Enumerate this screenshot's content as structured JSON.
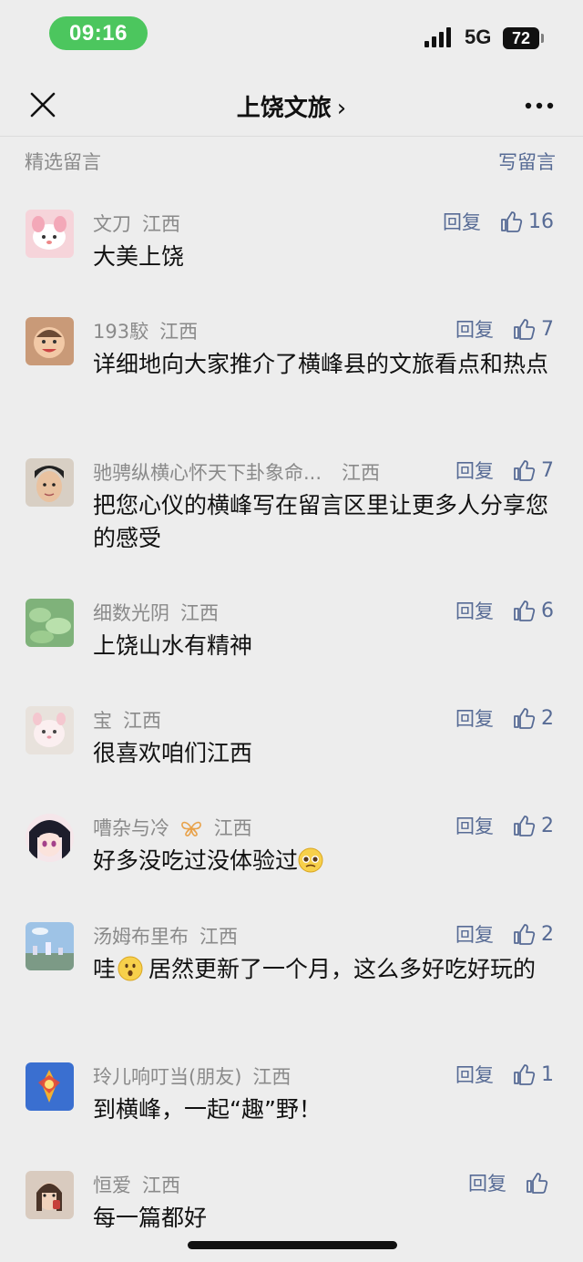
{
  "status_bar": {
    "time": "09:16",
    "network": "5G",
    "battery": "72"
  },
  "nav": {
    "title": "上饶文旅",
    "chevron": "›",
    "close_icon": "close-icon",
    "more_icon": "more-icon"
  },
  "section": {
    "title": "精选留言",
    "write_label": "写留言"
  },
  "reply_label": "回复",
  "comments": [
    {
      "name": "文刀",
      "region": "江西",
      "likes": "16",
      "text": "大美上饶"
    },
    {
      "name": "193駮",
      "region": "江西",
      "likes": "7",
      "text": "详细地向大家推介了横峰县的文旅看点和热点"
    },
    {
      "name": "驰骋纵横心怀天下卦象命...",
      "region": "江西",
      "likes": "7",
      "text": "把您心仪的横峰写在留言区里让更多人分享您的感受"
    },
    {
      "name": "细数光阴",
      "region": "江西",
      "likes": "6",
      "text": "上饶山水有精神"
    },
    {
      "name": "宝",
      "region": "江西",
      "likes": "2",
      "text": "很喜欢咱们江西"
    },
    {
      "name": "嘈杂与冷",
      "name_icon": "butterfly-icon",
      "region": "江西",
      "likes": "2",
      "text": "好多没吃过没体验过",
      "emoji": "pleading-face-emoji"
    },
    {
      "name": "汤姆布里布",
      "region": "江西",
      "likes": "2",
      "text_before": "哇",
      "emoji": "hushed-face-emoji",
      "text": "居然更新了一个月，这么多好吃好玩的"
    },
    {
      "name": "玲儿响叮当(朋友)",
      "region": "江西",
      "likes": "1",
      "text": "到横峰，一起“趣”野！"
    },
    {
      "name": "恒爱",
      "region": "江西",
      "likes": "",
      "text": "每一篇都好"
    }
  ]
}
